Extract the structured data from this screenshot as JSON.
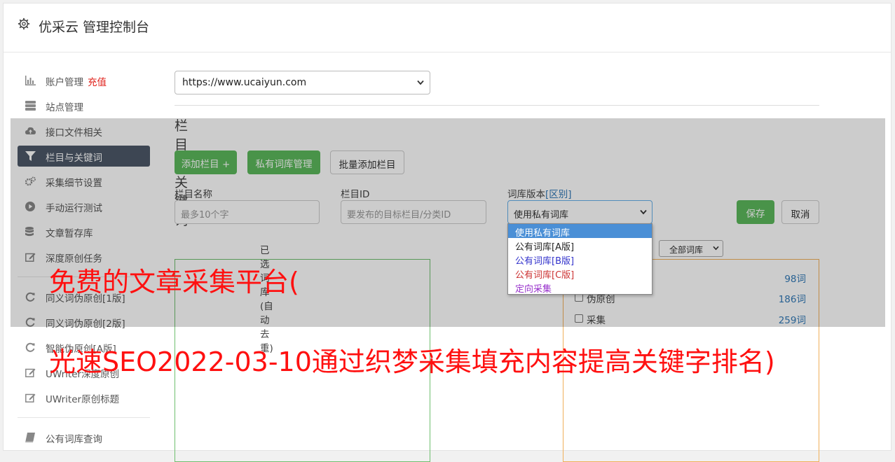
{
  "header": {
    "title": "优采云 管理控制台"
  },
  "sidebar": {
    "items": [
      {
        "label": "账户管理",
        "extra": "充值"
      },
      {
        "label": "站点管理"
      },
      {
        "label": "接口文件相关"
      },
      {
        "label": "栏目与关键词"
      },
      {
        "label": "采集细节设置"
      },
      {
        "label": "手动运行测试"
      },
      {
        "label": "文章暂存库"
      },
      {
        "label": "深度原创任务"
      },
      {
        "label": "同义词伪原创[1版]"
      },
      {
        "label": "同义词伪原创[2版]"
      },
      {
        "label": "智能伪原创[A版]"
      },
      {
        "label": "UWriter深度原创"
      },
      {
        "label": "UWriter原创标题"
      },
      {
        "label": "公有词库查询"
      }
    ]
  },
  "main": {
    "site_select": "https://www.ucaiyun.com",
    "section_title": "栏目与关键词",
    "buttons": {
      "add_column": "添加栏目 +",
      "private_lib": "私有词库管理",
      "batch_add": "批量添加栏目",
      "save": "保存",
      "cancel": "取消"
    },
    "form": {
      "name_label": "栏目名称",
      "name_placeholder": "最多10个字",
      "id_label": "栏目ID",
      "id_placeholder": "要发布的目标栏目/分类ID",
      "version_label": "词库版本",
      "version_diff": "[区别]",
      "version_value": "使用私有词库"
    },
    "version_options": [
      {
        "label": "使用私有词库",
        "color": "#ffffff"
      },
      {
        "label": "公有词库[A版]",
        "color": "#222222"
      },
      {
        "label": "公有词库[B版]",
        "color": "#3333cc"
      },
      {
        "label": "公有词库[C版]",
        "color": "#cc3333"
      },
      {
        "label": "定向采集",
        "color": "#9933cc"
      }
    ],
    "selected_caption": "已选词库(自动去重)",
    "lib_filter": "全部词库",
    "lib_rows": [
      {
        "name": "",
        "count": "98词"
      },
      {
        "name": "伪原创",
        "count": "186词"
      },
      {
        "name": "采集",
        "count": "259词"
      }
    ]
  },
  "watermark": {
    "line1": "免费的文章采集平台(",
    "line2": "光速SEO2022-03-10通过织梦采集填充内容提高关键字排名)"
  },
  "colors": {
    "accent_green": "#5cb85c",
    "active_nav": "#4d5868",
    "watermark_red": "#ff1010"
  }
}
